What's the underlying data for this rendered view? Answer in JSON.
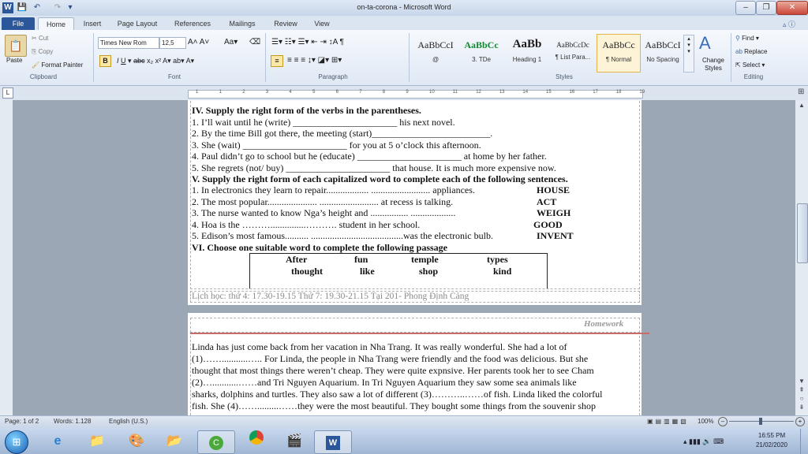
{
  "window": {
    "title": "on-ta-corona - Microsoft Word"
  },
  "tabs": [
    "File",
    "Home",
    "Insert",
    "Page Layout",
    "References",
    "Mailings",
    "Review",
    "View"
  ],
  "clipboard": {
    "paste": "Paste",
    "cut": "Cut",
    "copy": "Copy",
    "format_painter": "Format Painter",
    "group": "Clipboard"
  },
  "font": {
    "name": "Times New Rom",
    "size": "12,5",
    "group": "Font"
  },
  "paragraph": {
    "group": "Paragraph"
  },
  "styles": {
    "group": "Styles",
    "items": [
      {
        "preview": "AaBbCcI",
        "name": "@"
      },
      {
        "preview": "AaBbCc",
        "name": "3. TDe"
      },
      {
        "preview": "AaBb",
        "name": "Heading 1"
      },
      {
        "preview": "AaBbCcDc",
        "name": "¶ List Para..."
      },
      {
        "preview": "AaBbCc",
        "name": "¶ Normal"
      },
      {
        "preview": "AaBbCcI",
        "name": "No Spacing"
      }
    ],
    "change_styles": "Change Styles"
  },
  "editing": {
    "find": "Find",
    "replace": "Replace",
    "select": "Select",
    "group": "Editing"
  },
  "ruler_numbers": [
    "1",
    "1",
    "2",
    "3",
    "4",
    "5",
    "6",
    "7",
    "8",
    "9",
    "10",
    "11",
    "12",
    "13",
    "14",
    "15",
    "16",
    "17",
    "18",
    "19"
  ],
  "page1": {
    "lines": [
      {
        "text": "IV. Supply the right form of the verbs in the parentheses.",
        "bold": true
      },
      {
        "text": "1. I’ll wait until he (write) ______________________ his next novel."
      },
      {
        "text": "2. By the time Bill got there, the meeting (start)_________________________."
      },
      {
        "text": "3. She (wait) ______________________ for you at 5 o’clock this afternoon."
      },
      {
        "text": "4. Paul didn’t go to school but he (educate) ______________________ at home by her father."
      },
      {
        "text": "5. She regrets (not/ buy) ______________________ that house. It is much more expensive now."
      },
      {
        "text": "V. Supply the right form of each capitalized word to complete each of the following sentences.",
        "bold": true
      }
    ],
    "word_form": [
      {
        "text": "1. In electronics they learn to repair.................. ......................... appliances.",
        "word": "HOUSE"
      },
      {
        "text": "2. The most popular..................... .........................  at recess is talking.",
        "word": "ACT"
      },
      {
        "text": "3. The nurse wanted to know Nga’s height and ................ ...................",
        "word": "WEIGH"
      },
      {
        "text": "4. Hoa is the ………...............……….  student in her school.",
        "word": "GOOD"
      },
      {
        "text": "5. Edison’s most famous.......... .......................................was  the electronic bulb.",
        "word": "INVENT"
      }
    ],
    "section6": "VI.  Choose one suitable word to complete the following passage",
    "word_box": [
      [
        "After",
        "fun",
        "temple",
        "types"
      ],
      [
        "thought",
        "like",
        "shop",
        "kind"
      ]
    ],
    "footer": "Lịch học: thứ 4: 17.30-19.15   Thứ 7: 19.30-21.15  Tại 201- Phong Định Cảng"
  },
  "page2": {
    "header": "Homework",
    "lines": [
      " Linda has just come back from her vacation in Nha Trang. It was really wonderful. She had a lot of",
      "(1)……...........….. For Linda, the people in Nha Trang were friendly and the food was delicious. But she",
      "thought that most things there weren’t cheap. They were quite expnsive. Her parents took her to see Cham",
      "(2)…...........……and Tri Nguyen Aquarium. In Tri Nguyen Aquarium they saw some sea animals like",
      "sharks, dolphins and turtles. They also saw a lot of different (3)………..……of fish. Linda liked the colorful",
      "fish. She (4)…….........……they were the most beautiful. They bought some things from the souvenir shop"
    ]
  },
  "status": {
    "page": "Page: 1 of 2",
    "words": "Words: 1.128",
    "language": "English (U.S.)",
    "zoom": "100%"
  },
  "taskbar": {
    "time": "16:55 PM",
    "date": "21/02/2020"
  }
}
